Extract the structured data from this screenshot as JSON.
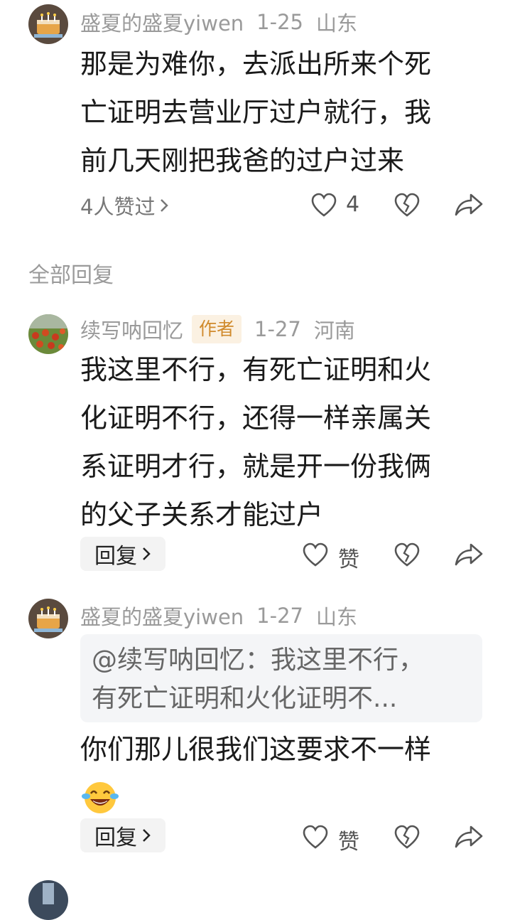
{
  "comment1": {
    "username": "盛夏的盛夏yiwen",
    "date": "1-25",
    "location": "山东",
    "lines": [
      "那是为难你，去派出所来个死",
      "亡证明去营业厅过户就行，我",
      "前几天刚把我爸的过户过来"
    ],
    "liked_by": "4人赞过",
    "like_count": "4"
  },
  "section_label": "全部回复",
  "reply1": {
    "username": "续写呐回忆",
    "badge": "作者",
    "date": "1-27",
    "location": "河南",
    "lines": [
      "我这里不行，有死亡证明和火",
      "化证明不行，还得一样亲属关",
      "系证明才行，就是开一份我俩",
      "的父子关系才能过户"
    ],
    "reply_label": "回复",
    "like_label": "赞"
  },
  "reply2": {
    "username": "盛夏的盛夏yiwen",
    "date": "1-27",
    "location": "山东",
    "quote_lines": [
      "@续写呐回忆：我这里不行，",
      "有死亡证明和火化证明不..."
    ],
    "text": "你们那儿很我们这要求不一样",
    "reply_label": "回复",
    "like_label": "赞"
  },
  "icons": [
    "heart-icon",
    "broken-heart-icon",
    "share-icon",
    "chevron-right-icon",
    "laughing-emoji"
  ]
}
